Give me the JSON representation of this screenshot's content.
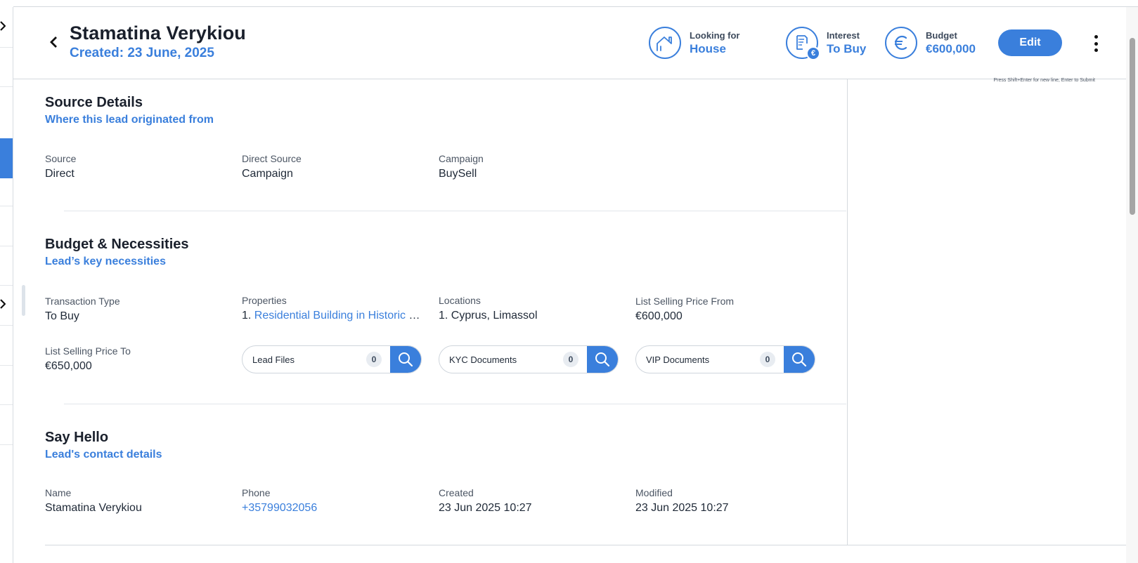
{
  "header": {
    "name": "Stamatina Verykiou",
    "created": "Created: 23 June, 2025",
    "stats": {
      "looking_for": {
        "label": "Looking for",
        "value": "House",
        "icon": "house-icon"
      },
      "interest": {
        "label": "Interest",
        "value": "To Buy",
        "icon": "document-euro-icon"
      },
      "budget": {
        "label": "Budget",
        "value": "€600,000",
        "icon": "euro-icon"
      }
    },
    "edit_label": "Edit"
  },
  "side_panel": {
    "hint": "Press Shift+Enter for new line, Enter to Submit"
  },
  "source_details": {
    "title": "Source Details",
    "subtitle": "Where this lead originated from",
    "fields": [
      {
        "label": "Source",
        "value": "Direct"
      },
      {
        "label": "Direct Source",
        "value": "Campaign"
      },
      {
        "label": "Campaign",
        "value": "BuySell"
      }
    ]
  },
  "budget_necessities": {
    "title": "Budget & Necessities",
    "subtitle": "Lead’s key necessities",
    "transaction_type": {
      "label": "Transaction Type",
      "value": "To Buy"
    },
    "properties": {
      "label": "Properties",
      "prefix": "1.",
      "value": "Residential Building in Historic Centre"
    },
    "locations": {
      "label": "Locations",
      "value": "1. Cyprus, Limassol"
    },
    "price_from": {
      "label": "List Selling Price From",
      "value": "€600,000"
    },
    "price_to": {
      "label": "List Selling Price To",
      "value": "€650,000"
    },
    "documents": [
      {
        "label": "Lead Files",
        "count": "0"
      },
      {
        "label": "KYC Documents",
        "count": "0"
      },
      {
        "label": "VIP Documents",
        "count": "0"
      }
    ]
  },
  "say_hello": {
    "title": "Say Hello",
    "subtitle": "Lead's contact details",
    "fields": [
      {
        "label": "Name",
        "value": "Stamatina Verykiou"
      },
      {
        "label": "Phone",
        "value": "+35799032056"
      },
      {
        "label": "Created",
        "value": "23 Jun 2025 10:27"
      },
      {
        "label": "Modified",
        "value": "23 Jun 2025 10:27"
      }
    ]
  },
  "colors": {
    "accent": "#3a7fdc",
    "text": "#1f2937",
    "muted": "#4b5563"
  }
}
